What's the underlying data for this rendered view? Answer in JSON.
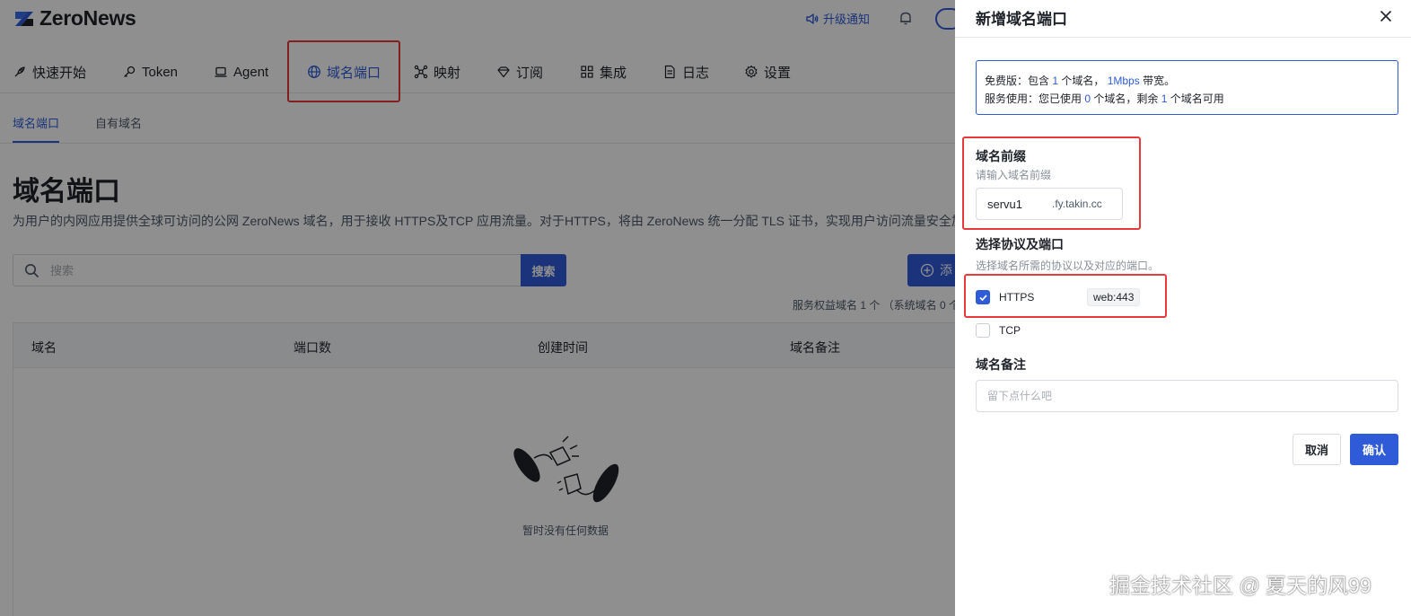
{
  "header": {
    "logo_text": "ZeroNews",
    "upgrade_label": "升级通知"
  },
  "nav": {
    "items": [
      {
        "label": "快速开始",
        "icon": "rocket-icon"
      },
      {
        "label": "Token",
        "icon": "key-icon"
      },
      {
        "label": "Agent",
        "icon": "laptop-icon"
      },
      {
        "label": "域名端口",
        "icon": "globe-icon"
      },
      {
        "label": "映射",
        "icon": "network-icon"
      },
      {
        "label": "订阅",
        "icon": "diamond-icon"
      },
      {
        "label": "集成",
        "icon": "grid-icon"
      },
      {
        "label": "日志",
        "icon": "document-icon"
      },
      {
        "label": "设置",
        "icon": "gear-icon"
      }
    ],
    "active_index": 3
  },
  "subnav": {
    "tabs": [
      "域名端口",
      "自有域名"
    ],
    "active_index": 0
  },
  "page": {
    "title": "域名端口",
    "description": "为用户的内网应用提供全球可访问的公网 ZeroNews 域名，用于接收 HTTPS及TCP 应用流量。对于HTTPS，将由 ZeroNews 统一分配 TLS 证书，实现用户访问流量安全加",
    "search_placeholder": "搜索",
    "search_button": "搜索",
    "add_button": "添",
    "quota_text": "服务权益域名 1 个 （系统域名 0 个"
  },
  "table": {
    "columns": [
      "域名",
      "端口数",
      "创建时间",
      "域名备注"
    ],
    "empty_text": "暂时没有任何数据"
  },
  "drawer": {
    "title": "新增域名端口",
    "notice": {
      "line1_prefix": "免费版：包含 ",
      "line1_count": "1",
      "line1_mid": " 个域名， ",
      "line1_bandwidth": "1Mbps",
      "line1_suffix": " 带宽。",
      "line2_prefix": "服务使用：您已使用 ",
      "line2_used": "0",
      "line2_mid": " 个域名，剩余 ",
      "line2_left": "1",
      "line2_suffix": " 个域名可用"
    },
    "prefix_label": "域名前缀",
    "prefix_hint": "请输入域名前缀",
    "prefix_value": "servu1",
    "prefix_suffix": ".fy.takin.cc",
    "protocol_label": "选择协议及端口",
    "protocol_hint": "选择域名所需的协议以及对应的端口。",
    "protocols": [
      {
        "name": "HTTPS",
        "checked": true,
        "port": "web:443"
      },
      {
        "name": "TCP",
        "checked": false,
        "port": ""
      }
    ],
    "remark_label": "域名备注",
    "remark_placeholder": "留下点什么吧",
    "cancel_label": "取消",
    "confirm_label": "确认"
  },
  "watermark": "掘金技术社区 @ 夏天的风99",
  "colors": {
    "primary": "#2f5bd9",
    "highlight_red": "#e83a3a",
    "overlay": "rgba(0,0,0,0.44)"
  }
}
